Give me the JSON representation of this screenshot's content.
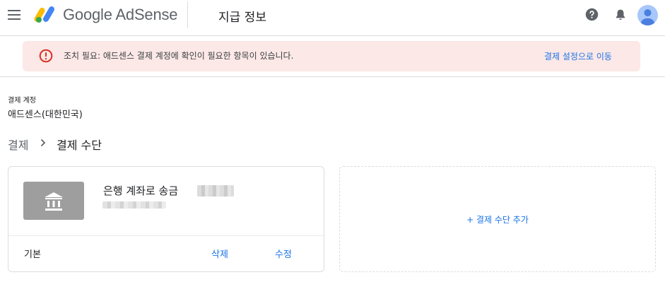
{
  "header": {
    "menu_icon": "hamburger-menu-icon",
    "brand": "Google AdSense",
    "page_title": "지급 정보",
    "icons": [
      "help-icon",
      "notifications-bell-icon",
      "account-avatar-icon"
    ],
    "brand_colors": {
      "yellow": "#fbbc04",
      "blue": "#4285f4",
      "green": "#34a853"
    }
  },
  "alert": {
    "icon": "error-circle-icon",
    "message": "조치 필요: 애드센스 결제 계정에 확인이 필요한 항목이 있습니다.",
    "link": "결제 설정으로 이동",
    "background": "#fce8e6",
    "icon_color": "#d93025"
  },
  "account": {
    "label": "결제 계정",
    "value": "애드센스(대한민국)"
  },
  "breadcrumb": {
    "parent": "결제",
    "current": "결제 수단"
  },
  "payment_method": {
    "icon": "bank-icon",
    "name": "은행 계좌로 송금",
    "status": "기본",
    "delete": "삭제",
    "edit": "수정"
  },
  "add_method": {
    "label": "+ 결제 수단 추가"
  },
  "colors": {
    "link": "#1a73e8",
    "border": "#dadce0",
    "tile": "#9e9e9e"
  }
}
